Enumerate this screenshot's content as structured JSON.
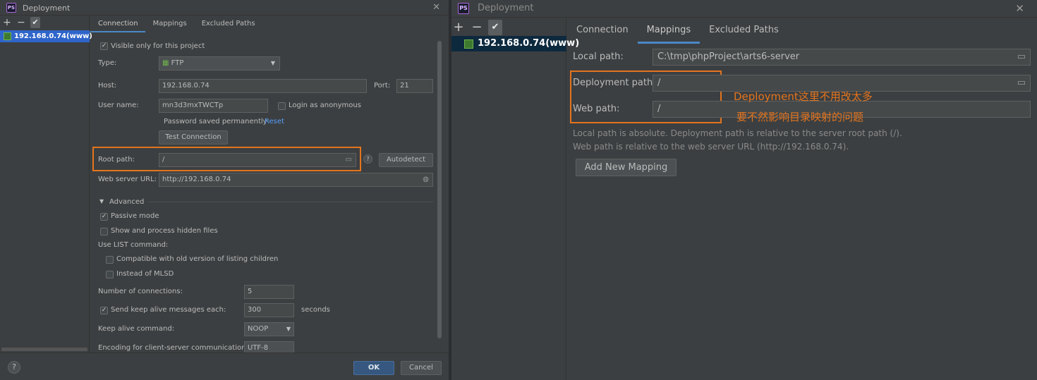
{
  "left_window": {
    "title": "Deployment",
    "toolbar": {
      "add": "+",
      "remove": "−",
      "check": "✔"
    },
    "server_name": "192.168.0.74(www)",
    "tabs": [
      "Connection",
      "Mappings",
      "Excluded Paths"
    ],
    "visible_only_label": "Visible only for this project",
    "visible_only_checked": true,
    "type_label": "Type:",
    "type_value": "FTP",
    "host_label": "Host:",
    "host_value": "192.168.0.74",
    "port_label": "Port:",
    "port_value": "21",
    "username_label": "User name:",
    "username_value": "mn3d3mxTWCTp",
    "anonymous_label": "Login as anonymous",
    "anonymous_checked": false,
    "password_text": "Password saved permanently",
    "reset_link": "Reset",
    "test_button": "Test Connection",
    "root_path_label": "Root path:",
    "root_path_value": "/",
    "help_mark": "?",
    "autodetect_button": "Autodetect",
    "web_url_label": "Web server URL:",
    "web_url_value": "http://192.168.0.74",
    "advanced_label": "Advanced",
    "passive_label": "Passive mode",
    "passive_checked": true,
    "hidden_files_label": "Show and process hidden files",
    "hidden_files_checked": false,
    "list_command_label": "Use  LIST command:",
    "compat_label": "Compatible with old version of listing children",
    "mlsd_label": "Instead of MLSD",
    "connections_label": "Number of connections:",
    "connections_value": "5",
    "keepalive_label": "Send keep alive messages each:",
    "keepalive_checked": true,
    "keepalive_value": "300",
    "keepalive_unit": "seconds",
    "keepalive_cmd_label": "Keep alive command:",
    "keepalive_cmd_value": "NOOP",
    "encoding_label": "Encoding for client-server communication:",
    "encoding_value": "UTF-8",
    "ok_button": "OK",
    "cancel_button": "Cancel",
    "footer_help": "?"
  },
  "right_window": {
    "title": "Deployment",
    "toolbar": {
      "add": "+",
      "remove": "−",
      "check": "✔"
    },
    "server_name": "192.168.0.74(www)",
    "tabs": [
      "Connection",
      "Mappings",
      "Excluded Paths"
    ],
    "local_path_label": "Local path:",
    "local_path_value": "C:\\tmp\\phpProject\\arts6-server",
    "deployment_path_label": "Deployment path:",
    "deployment_path_value": "/",
    "web_path_label": "Web path:",
    "web_path_value": "/",
    "info_line1": "Local path is absolute. Deployment path is relative to the server root path (/).",
    "info_line2": "Web path is relative to the web server URL (http://192.168.0.74).",
    "add_mapping_button": "Add New Mapping",
    "annotation_line1": "Deployment这里不用改太多",
    "annotation_line2": "要不然影响目录映射的问题"
  },
  "colors": {
    "background": "#3c3f41",
    "field_bg": "#45494a",
    "accent_blue": "#4a88c7",
    "ok_button": "#365880",
    "highlight_orange": "#e4741d",
    "link_blue": "#589df6"
  }
}
